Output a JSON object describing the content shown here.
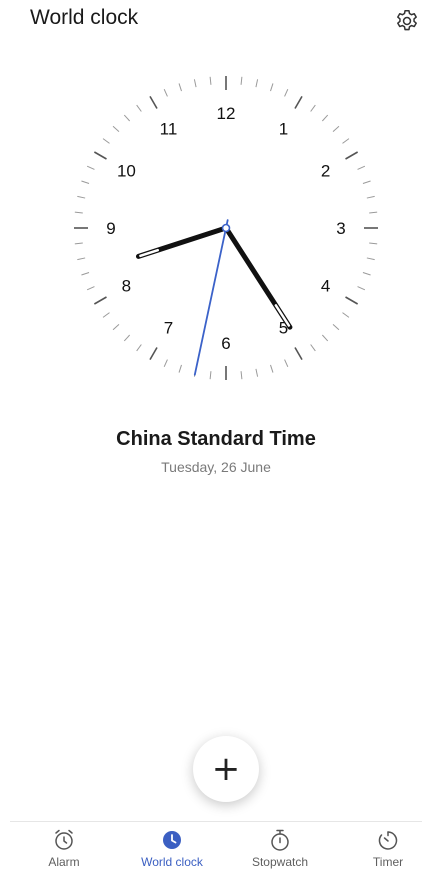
{
  "header": {
    "title": "World clock",
    "settings_icon": "gear-icon"
  },
  "clock": {
    "numbers": [
      "12",
      "1",
      "2",
      "3",
      "4",
      "5",
      "6",
      "7",
      "8",
      "9",
      "10",
      "11"
    ],
    "time": {
      "hour": 8,
      "minute": 24,
      "second": 32
    },
    "hand_color": "#111111",
    "second_hand_color": "#3b62c9"
  },
  "timezone": {
    "name": "China Standard Time",
    "date": "Tuesday, 26 June"
  },
  "fab": {
    "icon": "plus-icon",
    "label": "+"
  },
  "nav": {
    "active_color": "#3b5fc2",
    "items": [
      {
        "label": "Alarm",
        "icon": "alarm-clock-icon"
      },
      {
        "label": "World clock",
        "icon": "clock-icon"
      },
      {
        "label": "Stopwatch",
        "icon": "stopwatch-icon"
      },
      {
        "label": "Timer",
        "icon": "timer-icon"
      }
    ]
  }
}
